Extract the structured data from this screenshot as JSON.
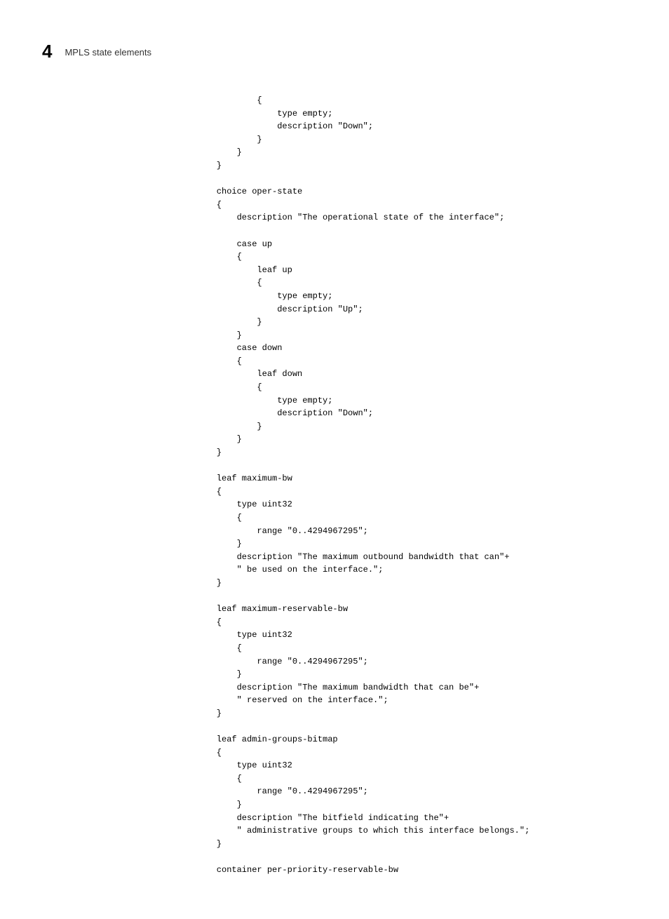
{
  "header": {
    "chapter_number": "4",
    "chapter_title": "MPLS state elements"
  },
  "code": "            {\n                type empty;\n                description \"Down\";\n            }\n        }\n    }\n\n    choice oper-state\n    {\n        description \"The operational state of the interface\";\n\n        case up\n        {\n            leaf up\n            {\n                type empty;\n                description \"Up\";\n            }\n        }\n        case down\n        {\n            leaf down\n            {\n                type empty;\n                description \"Down\";\n            }\n        }\n    }\n\n    leaf maximum-bw\n    {\n        type uint32\n        {\n            range \"0..4294967295\";\n        }\n        description \"The maximum outbound bandwidth that can\"+\n        \" be used on the interface.\";\n    }\n\n    leaf maximum-reservable-bw\n    {\n        type uint32\n        {\n            range \"0..4294967295\";\n        }\n        description \"The maximum bandwidth that can be\"+\n        \" reserved on the interface.\";\n    }\n\n    leaf admin-groups-bitmap\n    {\n        type uint32\n        {\n            range \"0..4294967295\";\n        }\n        description \"The bitfield indicating the\"+\n        \" administrative groups to which this interface belongs.\";\n    }\n\n    container per-priority-reservable-bw"
}
